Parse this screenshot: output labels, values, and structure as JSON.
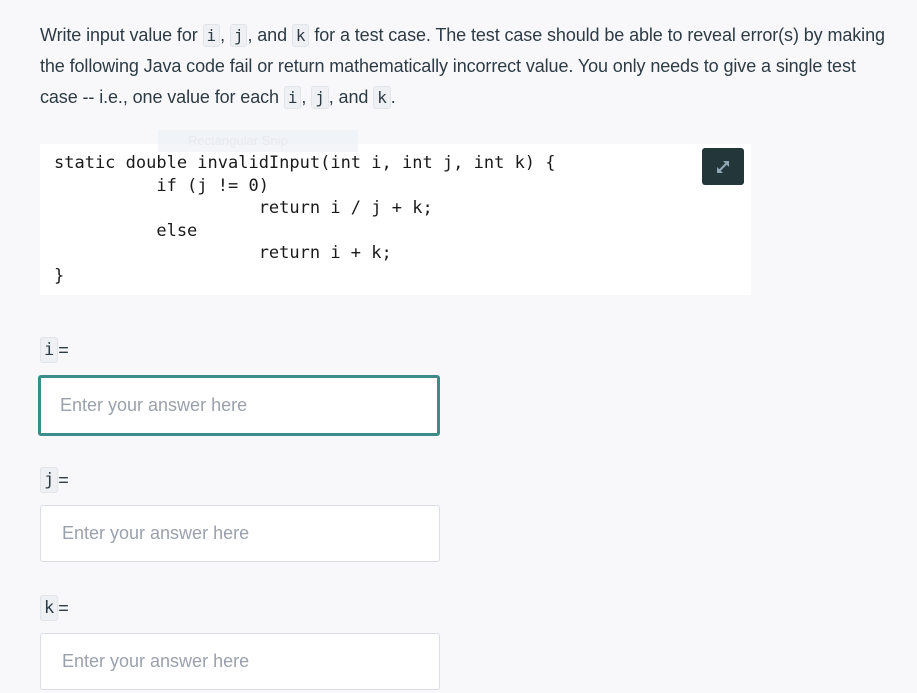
{
  "prompt": {
    "part1": "Write input value for ",
    "var_i": "i",
    "sep1": ", ",
    "var_j": "j",
    "sep2": ", and ",
    "var_k": "k",
    "part2": " for a test case. The test case should be able to reveal error(s) by making the following Java code fail or return mathematically incorrect value. You only needs to give a single test case -- i.e., one value for each ",
    "var_i2": "i",
    "sep3": ", ",
    "var_j2": "j",
    "sep4": ", and ",
    "var_k2": "k",
    "end": "."
  },
  "overlay": {
    "snip_label": "Rectangular Snip"
  },
  "code": {
    "language": "Java",
    "text": "static double invalidInput(int i, int j, int k) {\n          if (j != 0)\n                    return i / j + k;\n          else\n                    return i + k;\n}",
    "expand_icon": "expand-arrows-icon"
  },
  "inputs": [
    {
      "var": "i",
      "suffix": "=",
      "value": "",
      "placeholder": "Enter your answer here",
      "focused": true
    },
    {
      "var": "j",
      "suffix": "=",
      "value": "",
      "placeholder": "Enter your answer here",
      "focused": false
    },
    {
      "var": "k",
      "suffix": "=",
      "value": "",
      "placeholder": "Enter your answer here",
      "focused": false
    }
  ],
  "colors": {
    "focus_border": "#3c8d8a",
    "expand_button_bg": "#23363a",
    "text": "#2d3b45"
  }
}
